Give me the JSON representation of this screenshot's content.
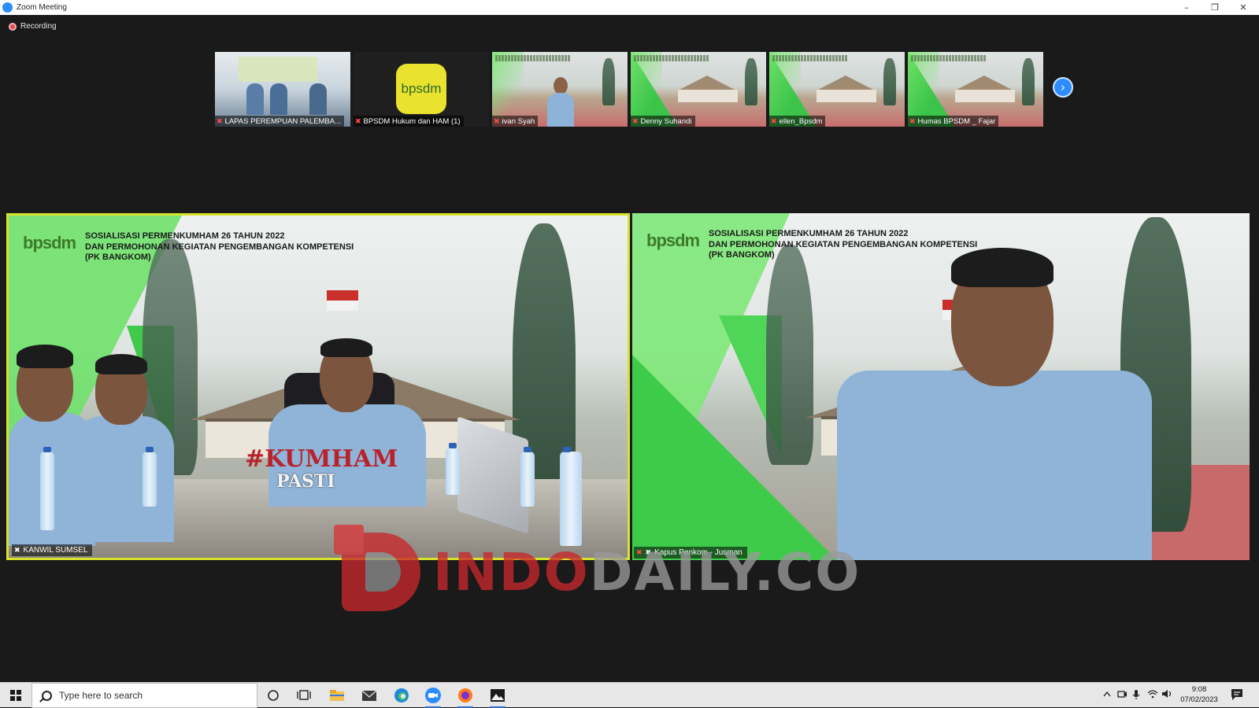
{
  "window": {
    "title": "Zoom Meeting",
    "minimize": "–",
    "restore": "❐",
    "close": "✕"
  },
  "recording": {
    "label": "Recording"
  },
  "thumbnails": [
    {
      "name": "LAPAS PEREMPUAN PALEMBA..."
    },
    {
      "name": "BPSDM Hukum dan HAM (1)",
      "logo_text": "bpsdm"
    },
    {
      "name": "ivan Syah"
    },
    {
      "name": "Denny Suhandi"
    },
    {
      "name": "ellen_Bpsdm"
    },
    {
      "name": "Humas BPSDM _ Fajar"
    }
  ],
  "next_button": {
    "glyph": "›"
  },
  "tiles": [
    {
      "name": "KANWIL SUMSEL",
      "logo": "bpsdm",
      "banner": [
        "SOSIALISASI PERMENKUMHAM  26 TAHUN 2022",
        "DAN PERMOHONAN KEGIATAN PENGEMBANGAN KOMPETENSI",
        "(PK BANGKOM)"
      ],
      "sign_top": "#KUMHAM",
      "sign_bottom": "PASTI"
    },
    {
      "name": "Kapus Penkom - Jusman",
      "logo": "bpsdm",
      "banner": [
        "SOSIALISASI PERMENKUMHAM  26 TAHUN 2022",
        "DAN PERMOHONAN KEGIATAN PENGEMBANGAN KOMPETENSI",
        "(PK BANGKOM)"
      ]
    }
  ],
  "watermark": {
    "indo": "INDO",
    "daily": "DAILY.CO"
  },
  "taskbar": {
    "search_placeholder": "Type here to search",
    "clock_time": "9:08",
    "clock_date": "07/02/2023"
  },
  "icons": {
    "pin": "✖",
    "mic_muted": "✖"
  },
  "colors": {
    "active_speaker_border": "#d7e22a",
    "zoom_blue": "#2d8cff",
    "muted_red": "#ff4a4a",
    "watermark_red": "#c8282c"
  }
}
